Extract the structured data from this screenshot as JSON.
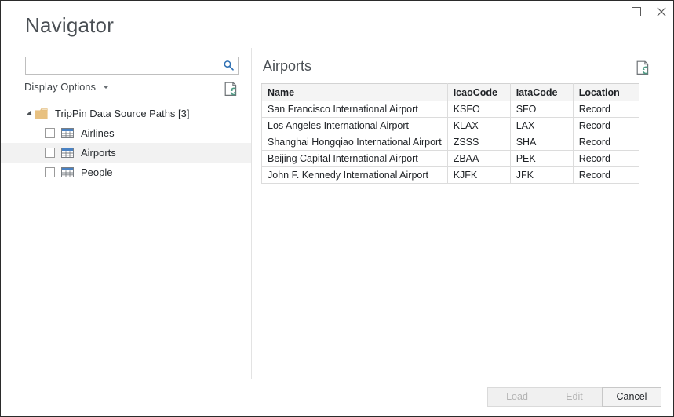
{
  "window": {
    "title": "Navigator",
    "controls": [
      {
        "name": "maximize-button",
        "icon": "maximize-icon",
        "label": "Maximize"
      },
      {
        "name": "close-button",
        "icon": "close-icon",
        "label": "Close"
      }
    ]
  },
  "left": {
    "search": {
      "value": "",
      "placeholder": "",
      "icon": "search-icon"
    },
    "display_options_label": "Display Options",
    "refresh_icon": "refresh-document-icon",
    "tree": {
      "root": {
        "label": "TripPin Data Source Paths [3]",
        "icon": "folder-icon",
        "expanded": true
      },
      "items": [
        {
          "label": "Airlines",
          "icon": "table-icon",
          "checked": false,
          "selected": false
        },
        {
          "label": "Airports",
          "icon": "table-icon",
          "checked": false,
          "selected": true
        },
        {
          "label": "People",
          "icon": "table-icon",
          "checked": false,
          "selected": false
        }
      ]
    }
  },
  "right": {
    "preview_title": "Airports",
    "refresh_icon": "refresh-document-icon",
    "table": {
      "columns": [
        "Name",
        "IcaoCode",
        "IataCode",
        "Location"
      ],
      "rows": [
        [
          "San Francisco International Airport",
          "KSFO",
          "SFO",
          "Record"
        ],
        [
          "Los Angeles International Airport",
          "KLAX",
          "LAX",
          "Record"
        ],
        [
          "Shanghai Hongqiao International Airport",
          "ZSSS",
          "SHA",
          "Record"
        ],
        [
          "Beijing Capital International Airport",
          "ZBAA",
          "PEK",
          "Record"
        ],
        [
          "John F. Kennedy International Airport",
          "KJFK",
          "JFK",
          "Record"
        ]
      ]
    }
  },
  "footer": {
    "buttons": [
      {
        "label": "Load",
        "enabled": false
      },
      {
        "label": "Edit",
        "enabled": false
      },
      {
        "label": "Cancel",
        "enabled": true
      }
    ]
  },
  "colors": {
    "accent_blue": "#2d6fb3",
    "folder_tan": "#e8c181",
    "refresh_green": "#4f9b84",
    "selected_row": "#f2f2f2",
    "header_bg": "#f4f4f4",
    "border": "#dcdcdc",
    "title_text": "#4a4f54"
  }
}
